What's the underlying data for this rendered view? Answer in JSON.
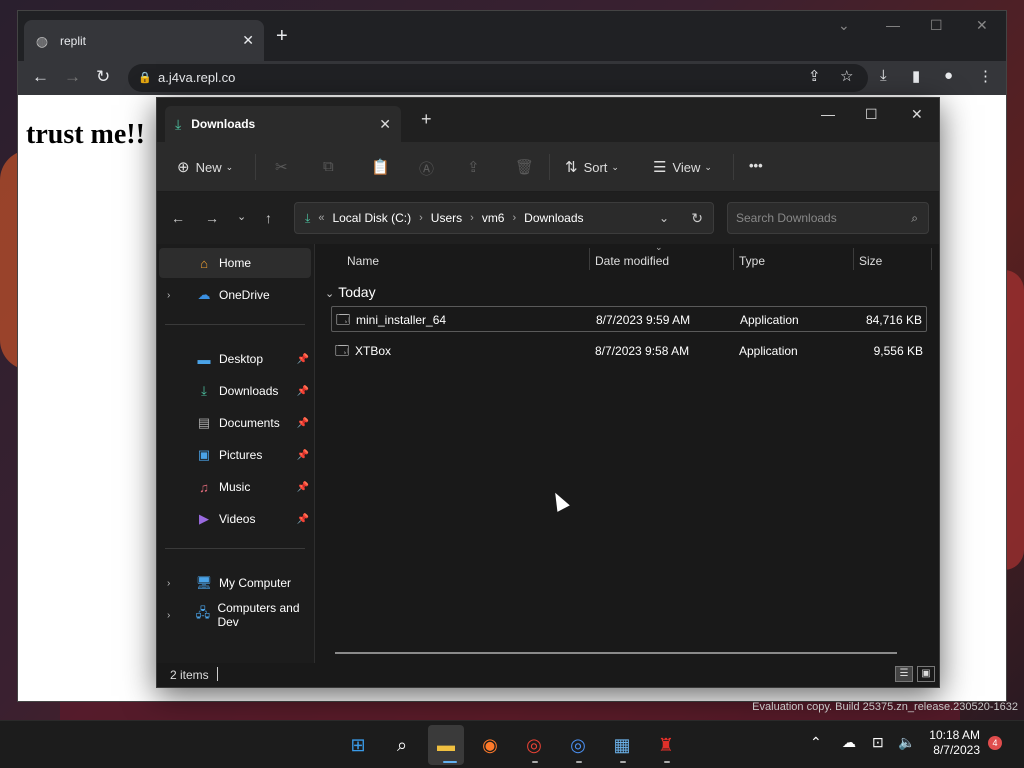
{
  "browser": {
    "tab_title": "replit",
    "url": "a.j4va.repl.co",
    "page_heading": "trust me!!"
  },
  "explorer": {
    "tab_title": "Downloads",
    "toolbar": {
      "new_label": "New",
      "sort_label": "Sort",
      "view_label": "View",
      "more_label": "•••"
    },
    "address": {
      "crumbs": [
        "Local Disk (C:)",
        "Users",
        "vm6",
        "Downloads"
      ],
      "search_placeholder": "Search Downloads"
    },
    "sidebar": {
      "home": "Home",
      "onedrive": "OneDrive",
      "desktop": "Desktop",
      "downloads": "Downloads",
      "documents": "Documents",
      "pictures": "Pictures",
      "music": "Music",
      "videos": "Videos",
      "my_computer": "My Computer",
      "computers": "Computers and Dev"
    },
    "columns": {
      "name": "Name",
      "date": "Date modified",
      "type": "Type",
      "size": "Size"
    },
    "group": "Today",
    "files": [
      {
        "name": "mini_installer_64",
        "date": "8/7/2023 9:59 AM",
        "type": "Application",
        "size": "84,716 KB"
      },
      {
        "name": "XTBox",
        "date": "8/7/2023 9:58 AM",
        "type": "Application",
        "size": "9,556 KB"
      }
    ],
    "status_count": "2 items"
  },
  "desktop": {
    "watermark": "Evaluation copy. Build 25375.zn_release.230520-1632"
  },
  "taskbar": {
    "time": "10:18 AM",
    "date": "8/7/2023",
    "notification_count": "4"
  }
}
